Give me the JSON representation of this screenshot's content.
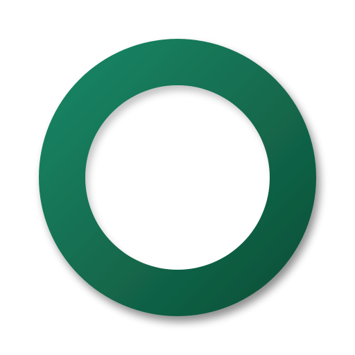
{
  "icon": {
    "name": "ring-icon",
    "shape": "ring",
    "colors": {
      "gradient_start": "#1b8a68",
      "gradient_end": "#0c4d35",
      "center": "#ffffff",
      "background": "#ffffff"
    }
  }
}
